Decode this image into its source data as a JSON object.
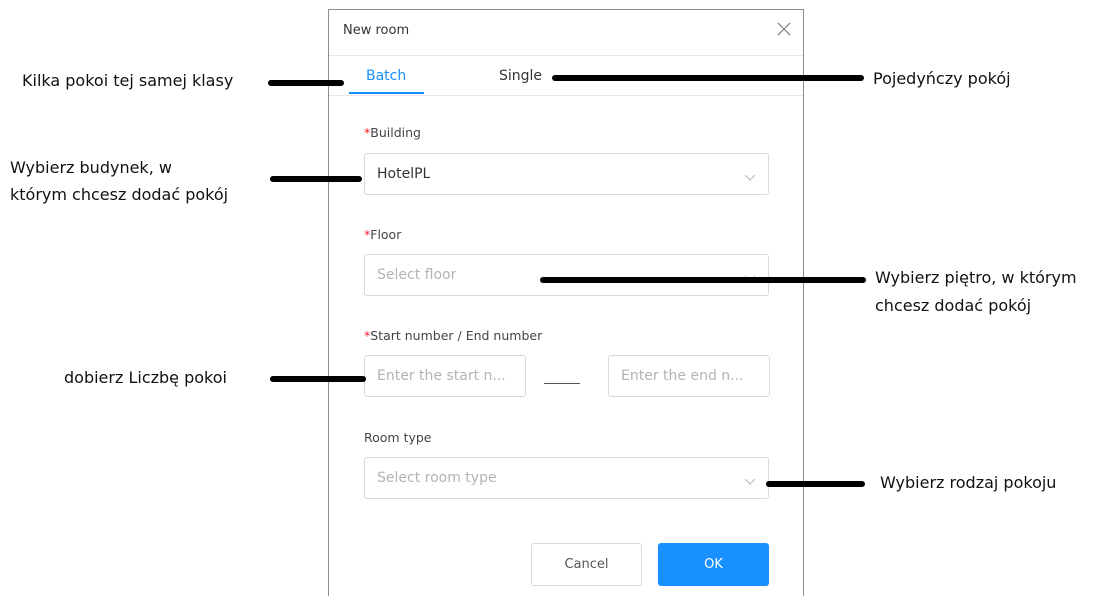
{
  "dialog": {
    "title": "New room",
    "tabs": [
      {
        "label": "Batch",
        "active": true
      },
      {
        "label": "Single",
        "active": false
      }
    ],
    "fields": {
      "building": {
        "required_mark": "*",
        "label": "Building",
        "value": "HotelPL"
      },
      "floor": {
        "required_mark": "*",
        "label": "Floor",
        "placeholder": "Select floor"
      },
      "range": {
        "required_mark": "*",
        "label": "Start number / End number",
        "start_placeholder": "Enter the start n...",
        "end_placeholder": "Enter the end n..."
      },
      "room_type": {
        "label": "Room type",
        "placeholder": "Select room type"
      }
    },
    "buttons": {
      "cancel": "Cancel",
      "ok": "OK"
    }
  },
  "annotations": {
    "batch": "Kilka pokoi tej samej klasy",
    "single": "Pojedyńczy pokój",
    "building_line1": "Wybierz budynek, w",
    "building_line2": "którym chcesz dodać pokój",
    "floor_line1": "Wybierz piętro, w którym",
    "floor_line2": "chcesz dodać pokój",
    "range": "dobierz Liczbę pokoi",
    "room_type": "Wybierz rodzaj pokoju"
  },
  "colors": {
    "accent": "#1890ff",
    "required": "#f5222d",
    "annotation_line": "#000000"
  }
}
